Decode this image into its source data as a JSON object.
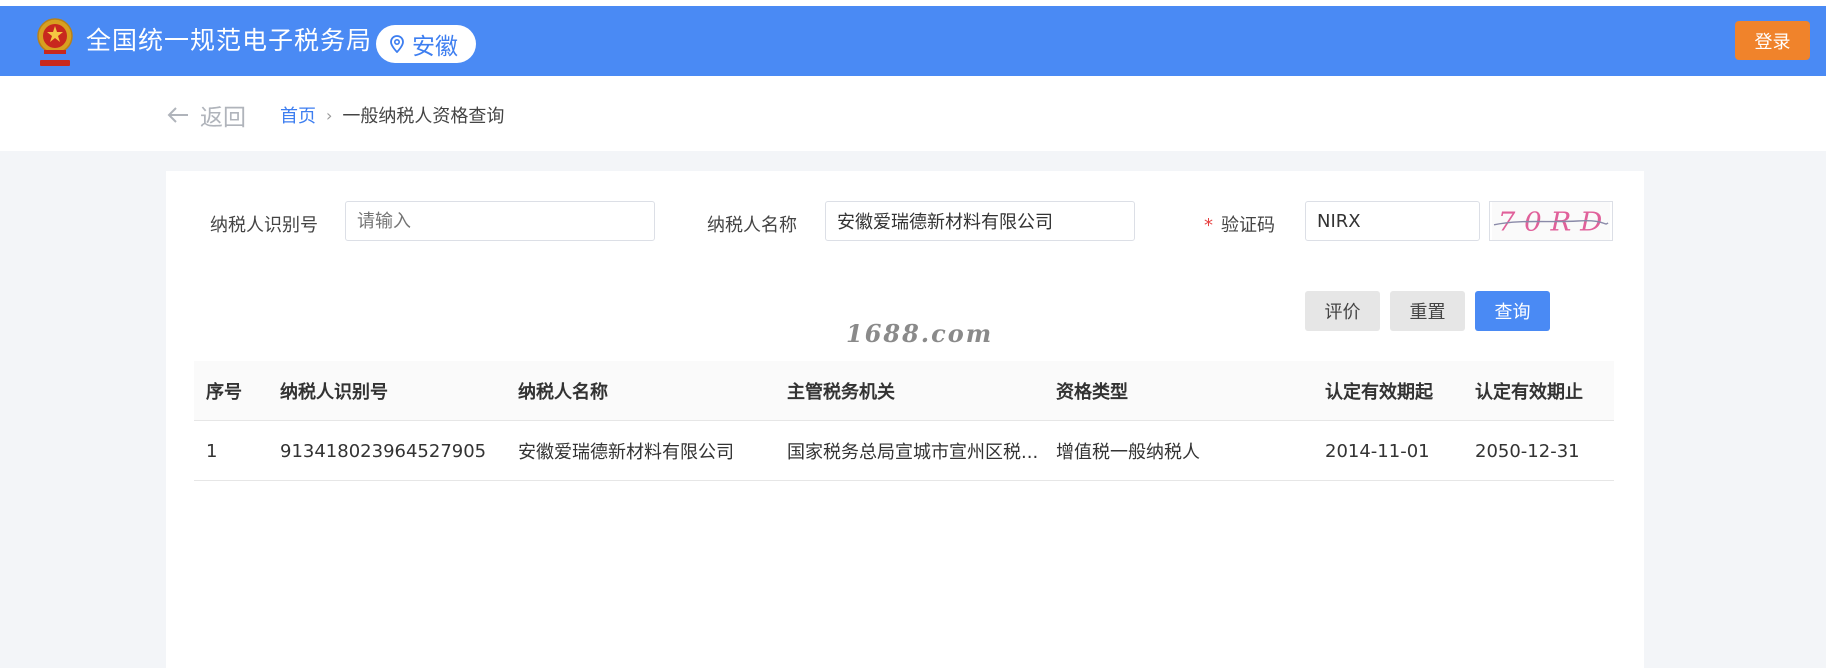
{
  "header": {
    "site_title": "全国统一规范电子税务局",
    "region": "安徽",
    "login_label": "登录",
    "accent_color": "#4a8af4"
  },
  "nav": {
    "back_label": "返回",
    "breadcrumb_home": "首页",
    "breadcrumb_separator": "›",
    "breadcrumb_current": "一般纳税人资格查询"
  },
  "form": {
    "taxpayer_id_label": "纳税人识别号",
    "taxpayer_id_value": "",
    "taxpayer_id_placeholder": "请输入",
    "taxpayer_name_label": "纳税人名称",
    "taxpayer_name_value": "安徽爱瑞德新材料有限公司",
    "captcha_label": "验证码",
    "captcha_required_mark": "*",
    "captcha_value": "NIRX",
    "captcha_image_text": "7 0 R D"
  },
  "buttons": {
    "evaluate": "评价",
    "reset": "重置",
    "query": "查询"
  },
  "watermark": "1688.com",
  "table": {
    "headers": [
      "序号",
      "纳税人识别号",
      "纳税人名称",
      "主管税务机关",
      "资格类型",
      "认定有效期起",
      "认定有效期止"
    ],
    "rows": [
      [
        "1",
        "913418023964527905",
        "安徽爱瑞德新材料有限公司",
        "国家税务总局宣城市宣州区税...",
        "增值税一般纳税人",
        "2014-11-01",
        "2050-12-31"
      ]
    ]
  }
}
